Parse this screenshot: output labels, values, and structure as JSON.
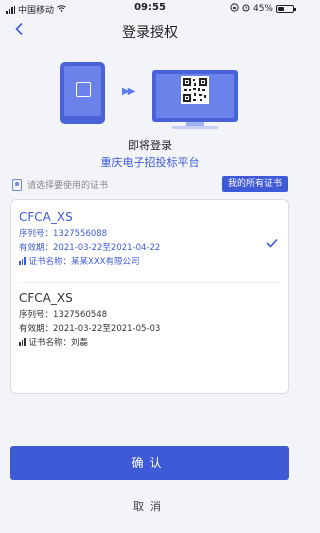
{
  "status_bar": {
    "carrier": "中国移动",
    "time": "09:55",
    "battery": "45%",
    "battery_level": 0.45
  },
  "nav": {
    "back_icon": "chevron-left-icon",
    "title": "登录授权"
  },
  "header": {
    "login_title": "即将登录",
    "platform_name": "重庆电子招投标平台"
  },
  "cert_select": {
    "hint": "请选择要使用的证书",
    "all_certs_button": "我的所有证书"
  },
  "certificates": [
    {
      "name": "CFCA_XS",
      "serial_label": "序列号：",
      "serial": "1327556088",
      "validity_label": "有效期：",
      "validity": "2021-03-22至2021-04-22",
      "holder_label": "证书名称：",
      "holder": "某某XXX有限公司",
      "selected": true
    },
    {
      "name": "CFCA_XS",
      "serial_label": "序列号：",
      "serial": "1327560548",
      "validity_label": "有效期：",
      "validity": "2021-03-22至2021-05-03",
      "holder_label": "证书名称：",
      "holder": "刘磊",
      "selected": false
    }
  ],
  "actions": {
    "confirm": "确认",
    "cancel": "取消"
  },
  "colors": {
    "accent": "#3f5ad6",
    "background": "#f3f4f8"
  }
}
